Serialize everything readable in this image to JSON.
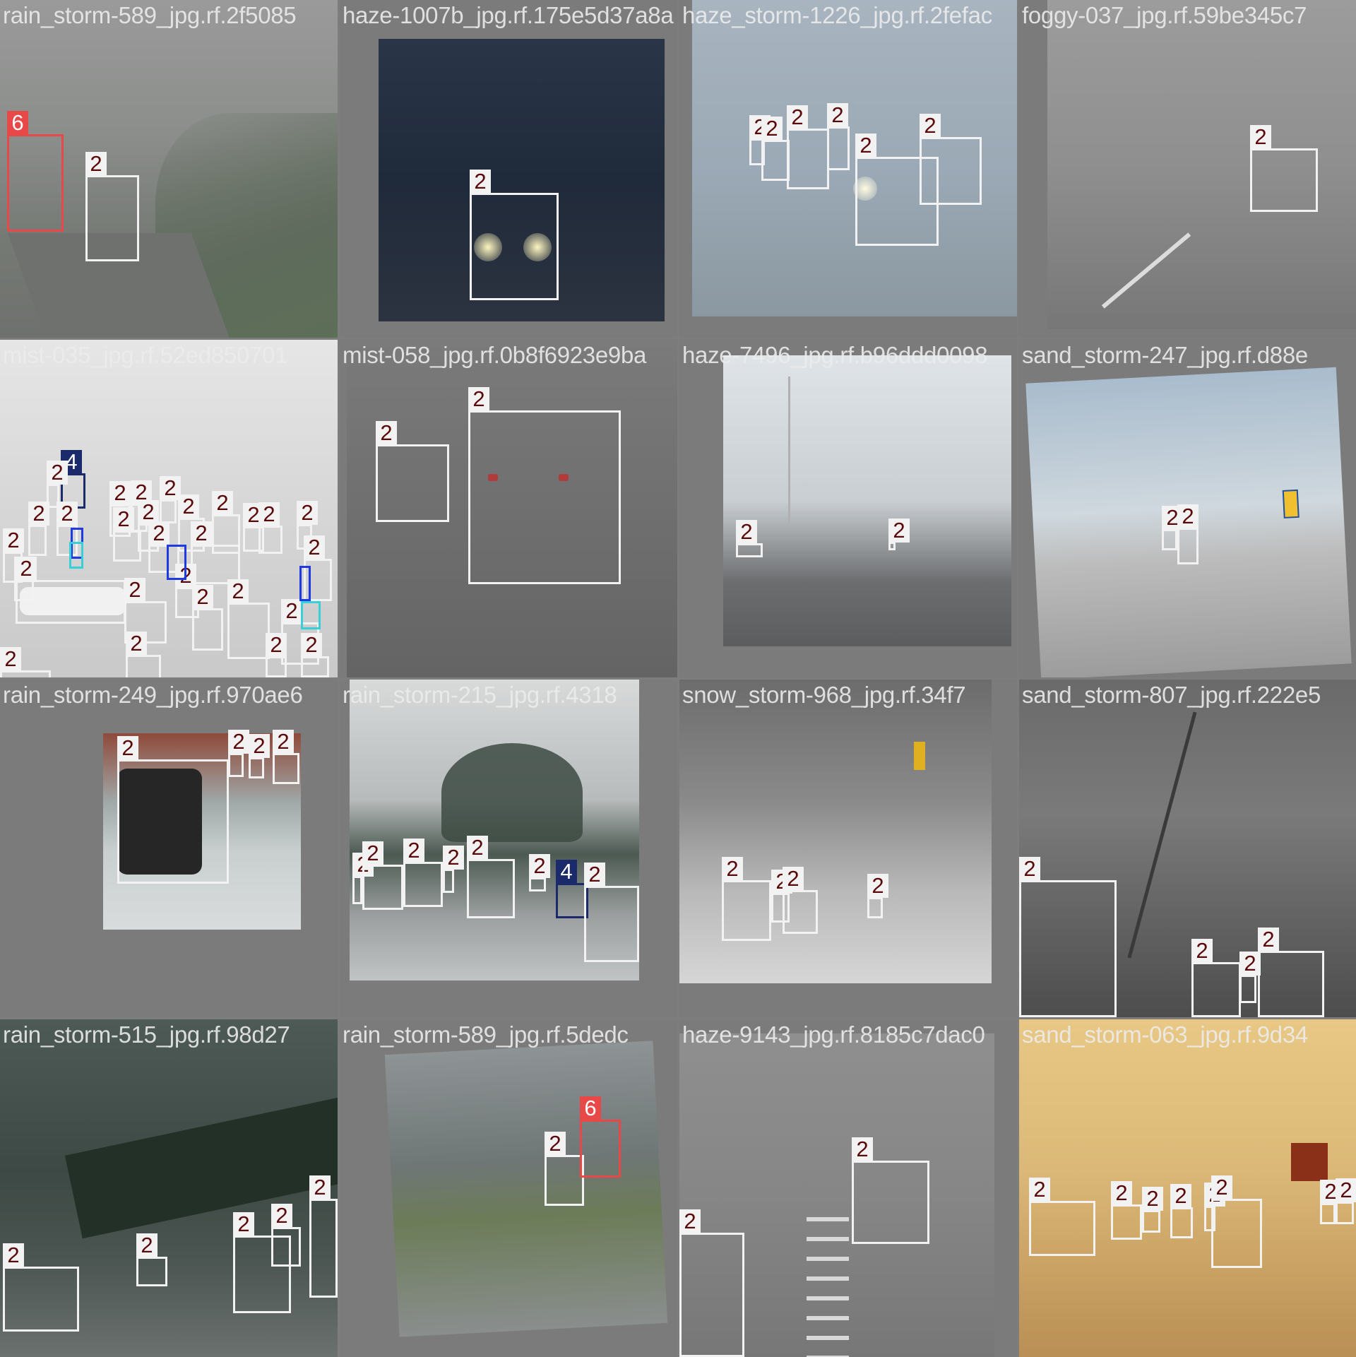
{
  "colors": {
    "canvas": "#7d7d7d",
    "box_car": "#f2f2f2",
    "box_class_6": "#e84848",
    "box_class_4": "#1a2a6a",
    "box_class_0": "#1f3ae0",
    "box_class_1": "#35d0d8",
    "label_text": "#5a0a0a"
  },
  "tiles": [
    {
      "filename": "rain_storm-589_jpg.rf.2f5085",
      "boxes": [
        "6",
        "2"
      ]
    },
    {
      "filename": "haze-1007b_jpg.rf.175e5d37a8a",
      "boxes": [
        "2"
      ]
    },
    {
      "filename": "haze_storm-1226_jpg.rf.2fefac",
      "boxes": [
        "2",
        "2",
        "2",
        "2",
        "2",
        "2"
      ]
    },
    {
      "filename": "foggy-037_jpg.rf.59be345c7",
      "boxes": [
        "2"
      ]
    },
    {
      "filename": "mist-035_jpg.rf.52ed850701",
      "boxes": [
        "4",
        "2",
        "2",
        "2",
        "2",
        "2",
        "2",
        "2",
        "2",
        "2",
        "2",
        "2",
        "2",
        "2",
        "2",
        "2",
        "2",
        "2",
        "2",
        "2",
        "2",
        "2",
        "2",
        "2",
        "2",
        "2",
        "2",
        "2",
        "2"
      ]
    },
    {
      "filename": "mist-058_jpg.rf.0b8f6923e9ba",
      "boxes": [
        "2",
        "2"
      ]
    },
    {
      "filename": "haze-7496_jpg.rf.b96ddd0098",
      "boxes": [
        "2",
        "2"
      ]
    },
    {
      "filename": "sand_storm-247_jpg.rf.d88e",
      "boxes": [
        "2",
        "2"
      ]
    },
    {
      "filename": "rain_storm-249_jpg.rf.970ae6",
      "boxes": [
        "2",
        "2",
        "2",
        "2"
      ]
    },
    {
      "filename": "rain_storm-215_jpg.rf.4318",
      "boxes": [
        "2",
        "2",
        "2",
        "2",
        "2",
        "2",
        "4",
        "2"
      ]
    },
    {
      "filename": "snow_storm-968_jpg.rf.34f7",
      "boxes": [
        "2",
        "2",
        "2",
        "2"
      ]
    },
    {
      "filename": "sand_storm-807_jpg.rf.222e5",
      "boxes": [
        "2",
        "2",
        "2",
        "2"
      ]
    },
    {
      "filename": "rain_storm-515_jpg.rf.98d27",
      "boxes": [
        "2",
        "2",
        "2",
        "2",
        "2"
      ]
    },
    {
      "filename": "rain_storm-589_jpg.rf.5dedc",
      "boxes": [
        "2",
        "6"
      ]
    },
    {
      "filename": "haze-9143_jpg.rf.8185c7dac0",
      "boxes": [
        "2",
        "2"
      ]
    },
    {
      "filename": "sand_storm-063_jpg.rf.9d34",
      "boxes": [
        "2",
        "2",
        "2",
        "2",
        "2",
        "2",
        "2",
        "2"
      ]
    }
  ]
}
